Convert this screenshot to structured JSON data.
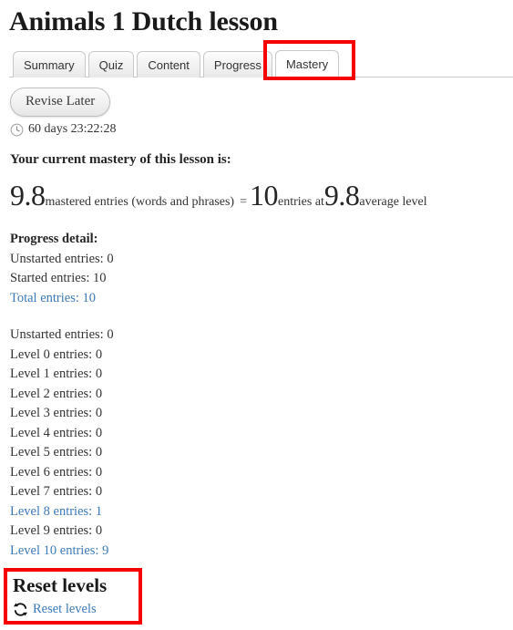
{
  "page": {
    "title": "Animals 1 Dutch lesson"
  },
  "tabs": [
    {
      "label": "Summary",
      "active": false
    },
    {
      "label": "Quiz",
      "active": false
    },
    {
      "label": "Content",
      "active": false
    },
    {
      "label": "Progress",
      "active": false
    },
    {
      "label": "Mastery",
      "active": true
    }
  ],
  "actions": {
    "revise_later_label": "Revise Later"
  },
  "timer": {
    "icon": "clock-icon",
    "text": "60 days 23:22:28"
  },
  "mastery": {
    "label": "Your current mastery of this lesson is:",
    "score": "9.8",
    "score_suffix": "mastered entries (words and phrases)",
    "equals": "=",
    "entry_count": "10",
    "entry_count_suffix": "entries at",
    "average_level": "9.8",
    "average_level_suffix": "average level"
  },
  "progress_detail": {
    "heading": "Progress detail:",
    "rows": [
      {
        "label": "Unstarted entries:",
        "value": "0",
        "link": false
      },
      {
        "label": "Started entries:",
        "value": "10",
        "link": false
      },
      {
        "label": "Total entries:",
        "value": "10",
        "link": true
      }
    ]
  },
  "levels_detail": {
    "rows": [
      {
        "label": "Unstarted entries:",
        "value": "0",
        "link": false
      },
      {
        "label": "Level 0 entries:",
        "value": "0",
        "link": false
      },
      {
        "label": "Level 1 entries:",
        "value": "0",
        "link": false
      },
      {
        "label": "Level 2 entries:",
        "value": "0",
        "link": false
      },
      {
        "label": "Level 3 entries:",
        "value": "0",
        "link": false
      },
      {
        "label": "Level 4 entries:",
        "value": "0",
        "link": false
      },
      {
        "label": "Level 5 entries:",
        "value": "0",
        "link": false
      },
      {
        "label": "Level 6 entries:",
        "value": "0",
        "link": false
      },
      {
        "label": "Level 7 entries:",
        "value": "0",
        "link": false
      },
      {
        "label": "Level 8 entries:",
        "value": "1",
        "link": true
      },
      {
        "label": "Level 9 entries:",
        "value": "0",
        "link": false
      },
      {
        "label": "Level 10 entries:",
        "value": "9",
        "link": true
      }
    ]
  },
  "reset_section": {
    "heading": "Reset levels",
    "link_label": "Reset levels",
    "icon": "refresh-icon"
  },
  "annotations": [
    {
      "name": "mastery-tab-highlight",
      "color": "#f40000"
    },
    {
      "name": "reset-levels-highlight",
      "color": "#f40000"
    }
  ],
  "colors": {
    "link": "#3c7ab8",
    "annotation": "#f40000",
    "text": "#333333",
    "heading": "#1a1a1a"
  }
}
